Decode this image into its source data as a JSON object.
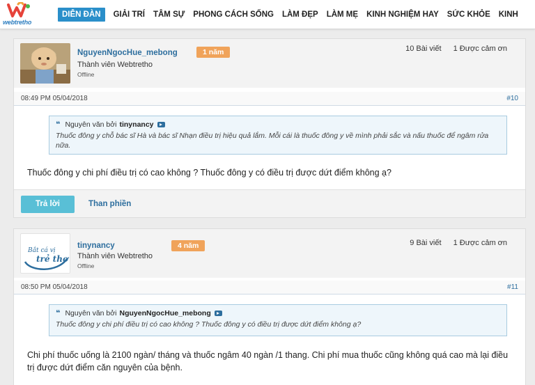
{
  "header": {
    "logo_text": "webtretho",
    "nav": [
      "DIỄN ĐÀN",
      "GIẢI TRÍ",
      "TÂM SỰ",
      "PHONG CÁCH SỐNG",
      "LÀM ĐẸP",
      "LÀM MẸ",
      "KINH NGHIỆM HAY",
      "SỨC KHỎE",
      "KINH"
    ],
    "active_index": 0
  },
  "posts": [
    {
      "username": "NguyenNgocHue_mebong",
      "badge": "1 năm",
      "rank": "Thành viên Webtretho",
      "status": "Offline",
      "posts_count": "10 Bài viết",
      "thanks": "1 Được cảm ơn",
      "date": "08:49 PM 05/04/2018",
      "number": "#10",
      "quote": {
        "prefix": "Nguyên văn bởi",
        "author": "tinynancy",
        "text": "Thuốc đông y chỗ bác sĩ Hà và bác sĩ Nhạn điều trị hiệu quả lắm. Mỗi cái là thuốc đông y về mình phải sắc và nấu thuốc để ngâm rửa nữa."
      },
      "content": "Thuốc đông y chi phí điều trị có cao không ? Thuốc đông y có điều trị được dứt điểm không ạ?",
      "reply_label": "Trả lời",
      "complain_label": "Than phiền"
    },
    {
      "username": "tinynancy",
      "badge": "4 năm",
      "rank": "Thành viên Webtretho",
      "status": "Offline",
      "avatar_text_1": "Bắt cá vị",
      "avatar_text_2": "trẻ thơ",
      "posts_count": "9 Bài viết",
      "thanks": "1 Được cảm ơn",
      "date": "08:50 PM 05/04/2018",
      "number": "#11",
      "quote": {
        "prefix": "Nguyên văn bởi",
        "author": "NguyenNgocHue_mebong",
        "text": "Thuốc đông y chi phí điều trị có cao không ? Thuốc đông y có điều trị được dứt điểm không ạ?"
      },
      "content": "Chi phí thuốc uống là 2100 ngàn/ tháng và thuốc ngâm 40 ngàn /1 thang. Chi phí mua thuốc cũng không quá cao mà lại điều trị được dứt điểm căn nguyên của bệnh."
    }
  ],
  "colors": {
    "brand_blue": "#2a8fca",
    "badge_orange": "#f0a35a",
    "reply_button": "#59bfd6",
    "link_blue": "#2d6e9e"
  }
}
